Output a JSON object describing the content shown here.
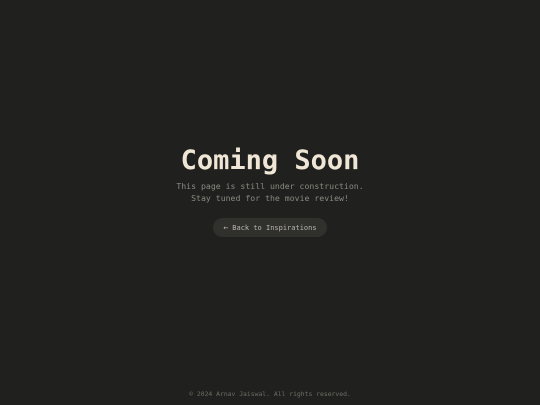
{
  "page": {
    "title": "Coming Soon",
    "subtitle_line1": "This page is still under construction.",
    "subtitle_line2": "Stay tuned for the movie review!"
  },
  "back_button": {
    "icon": "arrow-left-icon",
    "label": "Back to Inspirations"
  },
  "footer": {
    "text": "© 2024 Arnav Jaiswal. All rights reserved."
  },
  "colors": {
    "background": "#20211e",
    "title": "#efe6d6",
    "muted_text": "#8a8982",
    "button_bg": "#30312d"
  }
}
